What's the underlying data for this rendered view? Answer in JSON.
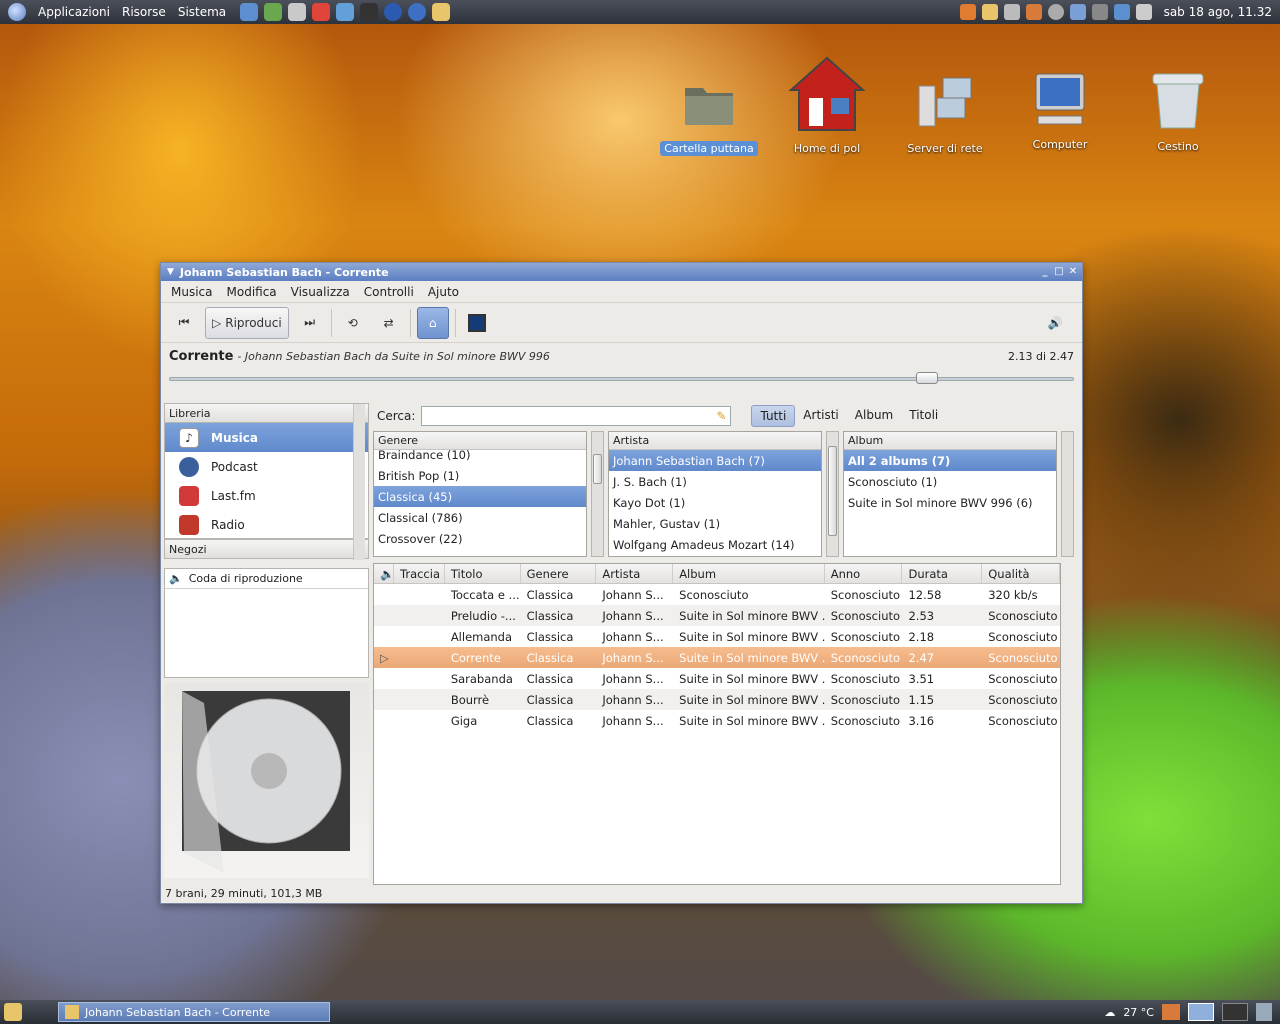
{
  "panel": {
    "menus": [
      "Applicazioni",
      "Risorse",
      "Sistema"
    ],
    "clock": "sab 18 ago, 11.32"
  },
  "desktop": {
    "icons": [
      {
        "label": "Cartella puttana",
        "icon": "folder-icon"
      },
      {
        "label": "Home di pol",
        "icon": "home-icon"
      },
      {
        "label": "Server di rete",
        "icon": "network-server-icon"
      },
      {
        "label": "Computer",
        "icon": "computer-icon"
      },
      {
        "label": "Cestino",
        "icon": "trash-icon"
      }
    ]
  },
  "window": {
    "title": "Johann Sebastian Bach - Corrente"
  },
  "menubar": [
    "Musica",
    "Modifica",
    "Visualizza",
    "Controlli",
    "Ajuto"
  ],
  "toolbar": {
    "play_label": "Riproduci"
  },
  "now_playing": {
    "title": "Corrente",
    "description": "- Johann Sebastian Bach da Suite in Sol minore BWV 996",
    "time": "2.13 di 2.47",
    "progress": 0.86
  },
  "sidebar": {
    "library_header": "Libreria",
    "items": [
      {
        "label": "Musica",
        "icon": "music-note-icon",
        "color": "#333333"
      },
      {
        "label": "Podcast",
        "icon": "podcast-icon",
        "color": "#3a5f9a"
      },
      {
        "label": "Last.fm",
        "icon": "lastfm-icon",
        "color": "#d23a3a"
      },
      {
        "label": "Radio",
        "icon": "radio-icon",
        "color": "#c0392b"
      }
    ],
    "stores_header": "Negozi",
    "queue_label": "Coda di riproduzione"
  },
  "search": {
    "label": "Cerca:",
    "value": "",
    "filters": [
      "Tutti",
      "Artisti",
      "Album",
      "Titoli"
    ]
  },
  "genre_browser": {
    "header": "Genere",
    "rows": [
      "Braindance (10)",
      "British Pop (1)",
      "Classica (45)",
      "Classical (786)",
      "Crossover (22)"
    ]
  },
  "artist_browser": {
    "header": "Artista",
    "rows": [
      "Johann Sebastian Bach (7)",
      "J. S. Bach (1)",
      "Kayo Dot (1)",
      "Mahler, Gustav (1)",
      "Wolfgang Amadeus Mozart (14)"
    ]
  },
  "album_browser": {
    "header": "Album",
    "rows": [
      "All 2 albums (7)",
      "Sconosciuto (1)",
      "Suite in Sol minore BWV 996 (6)"
    ]
  },
  "tracks": {
    "columns": [
      "Traccia",
      "Titolo",
      "Genere",
      "Artista",
      "Album",
      "Anno",
      "Durata",
      "Qualità"
    ],
    "rows": [
      [
        "",
        "Toccata e ...",
        "Classica",
        "Johann S...",
        "Sconosciuto",
        "Sconosciuto",
        "12.58",
        "320 kb/s"
      ],
      [
        "",
        "Preludio -...",
        "Classica",
        "Johann S...",
        "Suite in Sol minore BWV ...",
        "Sconosciuto",
        "2.53",
        "Sconosciuto"
      ],
      [
        "",
        "Allemanda",
        "Classica",
        "Johann S...",
        "Suite in Sol minore BWV ...",
        "Sconosciuto",
        "2.18",
        "Sconosciuto"
      ],
      [
        "",
        "Corrente",
        "Classica",
        "Johann S...",
        "Suite in Sol minore BWV ...",
        "Sconosciuto",
        "2.47",
        "Sconosciuto"
      ],
      [
        "",
        "Sarabanda",
        "Classica",
        "Johann S...",
        "Suite in Sol minore BWV ...",
        "Sconosciuto",
        "3.51",
        "Sconosciuto"
      ],
      [
        "",
        "Bourrè",
        "Classica",
        "Johann S...",
        "Suite in Sol minore BWV ...",
        "Sconosciuto",
        "1.15",
        "Sconosciuto"
      ],
      [
        "",
        "Giga",
        "Classica",
        "Johann S...",
        "Suite in Sol minore BWV ...",
        "Sconosciuto",
        "3.16",
        "Sconosciuto"
      ]
    ]
  },
  "status": "7 brani, 29 minuti, 101,3 MB",
  "taskbar": {
    "task": "Johann Sebastian Bach - Corrente",
    "weather": "27 °C"
  }
}
